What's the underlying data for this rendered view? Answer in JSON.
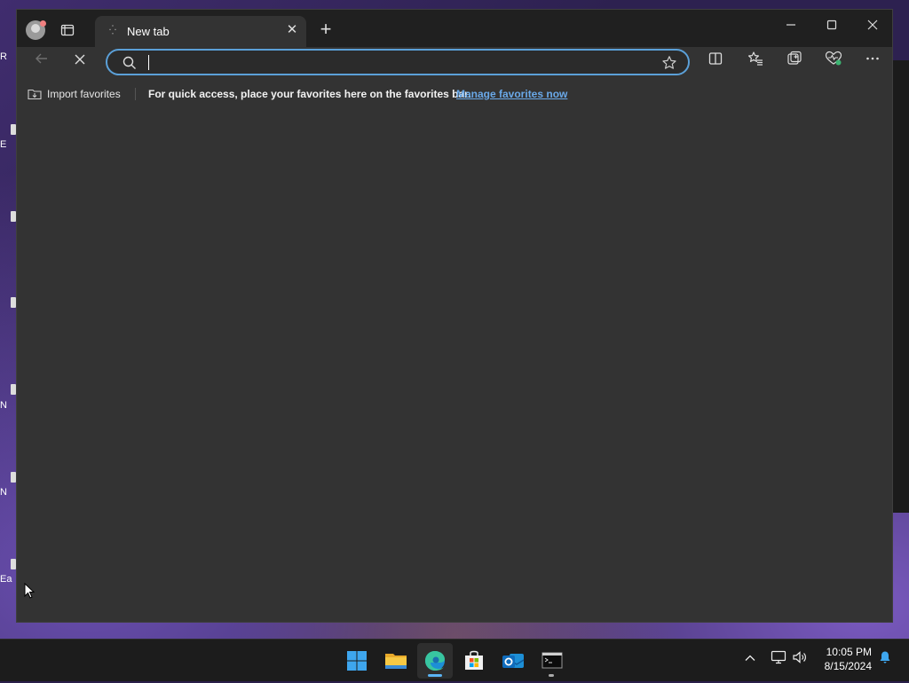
{
  "desktop": {
    "labels": [
      "R",
      "E",
      "N",
      "N",
      "Ea"
    ]
  },
  "browser": {
    "tab": {
      "title": "New tab"
    },
    "address_bar": {
      "value": "",
      "placeholder": ""
    },
    "favorites_bar": {
      "import_label": "Import favorites",
      "message": "For quick access, place your favorites here on the favorites bar.",
      "link": "Manage favorites now"
    }
  },
  "taskbar": {
    "apps": [
      "start-icon",
      "file-explorer-icon",
      "edge-icon",
      "microsoft-store-icon",
      "outlook-icon",
      "terminal-icon"
    ],
    "clock": {
      "time": "10:05 PM",
      "date": "8/15/2024"
    }
  },
  "colors": {
    "accent": "#5ba0d8",
    "link": "#6aa9e9",
    "titlebar": "#202020",
    "content": "#333333",
    "taskbar": "#1c1c1c"
  }
}
